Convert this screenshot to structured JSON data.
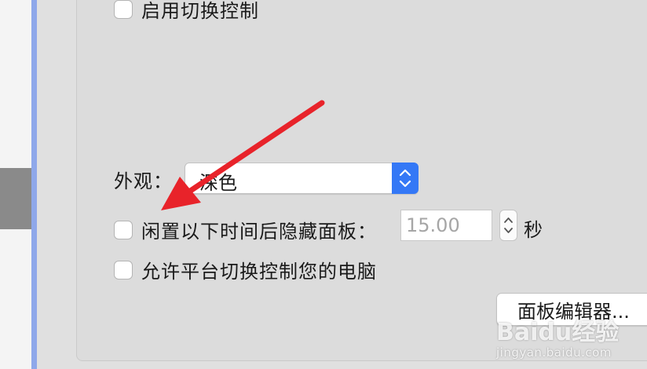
{
  "settings": {
    "enable_switch_control_label": "启用切换控制",
    "appearance_label": "外观：",
    "appearance_value": "深色",
    "hide_panel_label": "闲置以下时间后隐藏面板：",
    "hide_panel_seconds_placeholder": "15.00",
    "seconds_unit": "秒",
    "allow_platform_label": "允许平台切换控制您的电脑",
    "panel_editor_button": "面板编辑器..."
  },
  "watermark": {
    "logo": "Baidu经验",
    "url": "jingyan.baidu.com"
  },
  "colors": {
    "accent": "#3478f6",
    "annotation_arrow": "#e8232a",
    "sidebar_edge": "#8fa8ea"
  }
}
